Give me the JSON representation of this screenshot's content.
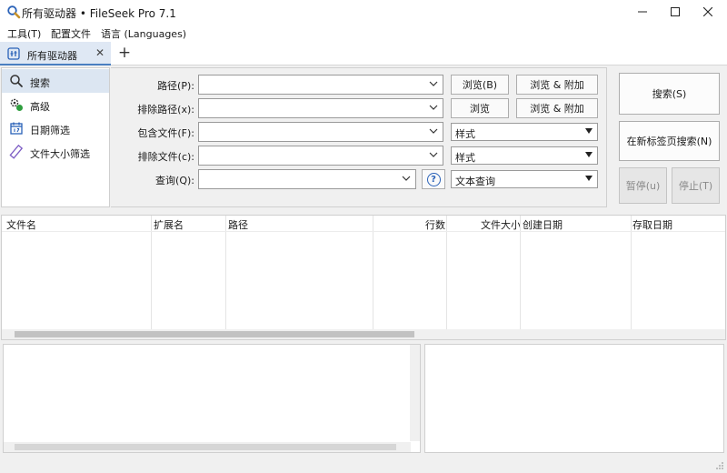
{
  "window": {
    "title": "所有驱动器 • FileSeek Pro 7.1",
    "icon": "magnifier-icon",
    "controls": {
      "minimize": "—",
      "maximize": "☐",
      "close": "✕"
    }
  },
  "menu": {
    "tools": "工具(T)",
    "config": "配置文件",
    "language": "语言 (Languages)"
  },
  "tabs": {
    "active_label": "所有驱动器",
    "close_glyph": "✕",
    "add_glyph": "+"
  },
  "sidebar": {
    "items": [
      {
        "label": "搜索",
        "icon": "search-icon",
        "active": true
      },
      {
        "label": "高级",
        "icon": "advanced-gears-icon",
        "active": false
      },
      {
        "label": "日期筛选",
        "icon": "calendar-icon",
        "active": false
      },
      {
        "label": "文件大小筛选",
        "icon": "ruler-icon",
        "active": false
      }
    ]
  },
  "form": {
    "path_label": "路径(P):",
    "exclude_path_label": "排除路径(x):",
    "include_files_label": "包含文件(F):",
    "exclude_files_label": "排除文件(c):",
    "query_label": "查询(Q):",
    "path_value": "",
    "exclude_path_value": "",
    "include_files_value": "",
    "exclude_files_value": "",
    "query_value": "",
    "browse_b": "浏览(B)",
    "browse_append_1": "浏览 & 附加",
    "browse": "浏览",
    "browse_append_2": "浏览 & 附加",
    "include_style": "样式",
    "exclude_style": "样式",
    "query_help": "?",
    "query_type": "文本查询"
  },
  "actions": {
    "search": "搜索(S)",
    "search_new_tab": "在新标签页搜索(N)",
    "pause": "暂停(u)",
    "stop": "停止(T)"
  },
  "results": {
    "columns": [
      "文件名",
      "扩展名",
      "路径",
      "行数",
      "文件大小",
      "创建日期",
      "存取日期"
    ],
    "rows": []
  },
  "colors": {
    "accent": "#4a7fc1",
    "active_bg": "#dce6f2",
    "window_bg": "#f0f0f0"
  }
}
